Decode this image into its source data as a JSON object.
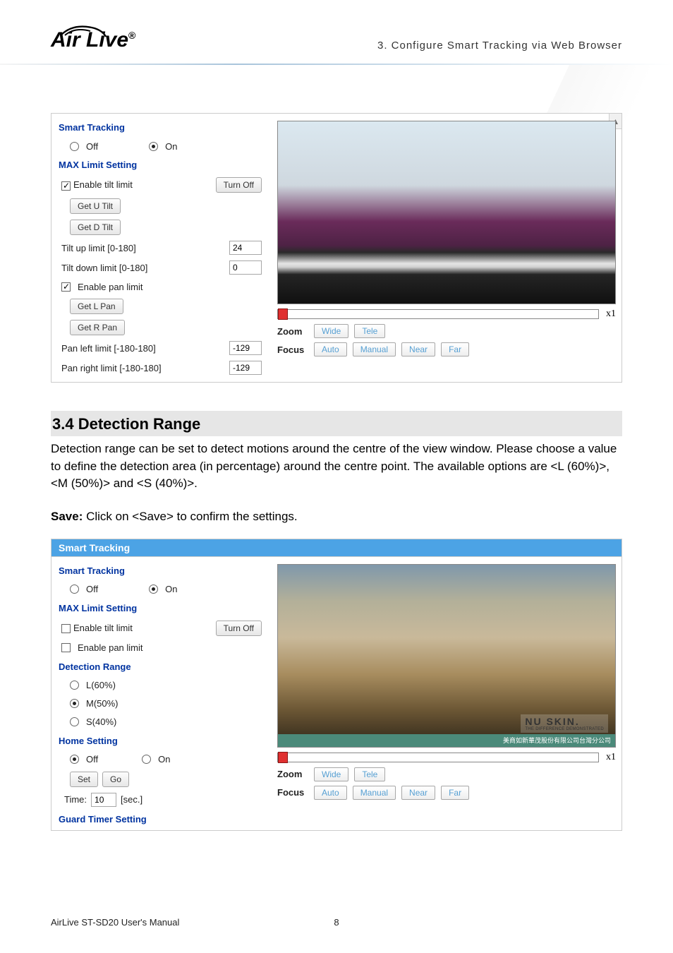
{
  "header": {
    "logo_text": "Air Live",
    "page_header": "3. Configure Smart Tracking via Web Browser"
  },
  "panel1": {
    "smart_tracking_hdr": "Smart Tracking",
    "off": "Off",
    "on": "On",
    "max_limit_hdr": "MAX Limit Setting",
    "enable_tilt": "Enable tilt limit",
    "turn_off": "Turn Off",
    "get_u_tilt": "Get U Tilt",
    "get_d_tilt": "Get D Tilt",
    "tilt_up_label": "Tilt up limit [0-180]",
    "tilt_up_val": "24",
    "tilt_down_label": "Tilt down limit [0-180]",
    "tilt_down_val": "0",
    "enable_pan": "Enable pan limit",
    "get_l_pan": "Get L Pan",
    "get_r_pan": "Get R Pan",
    "pan_left_label": "Pan left limit [-180-180]",
    "pan_left_val": "-129",
    "pan_right_label": "Pan right limit [-180-180]",
    "pan_right_val": "-129",
    "zoom_x": "x1",
    "zoom": "Zoom",
    "wide": "Wide",
    "tele": "Tele",
    "focus": "Focus",
    "auto": "Auto",
    "manual": "Manual",
    "near": "Near",
    "far": "Far"
  },
  "section": {
    "title": "3.4 Detection Range",
    "para": "Detection range can be set to detect motions around the centre of the view window. Please choose a value to define the detection area (in percentage) around the centre point. The available options are <L (60%)>, <M (50%)> and <S (40%)>.",
    "save_label": "Save:",
    "save_text": " Click on <Save> to confirm the settings."
  },
  "panel2": {
    "tab": "Smart Tracking",
    "smart_tracking_hdr": "Smart Tracking",
    "off": "Off",
    "on": "On",
    "max_limit_hdr": "MAX Limit Setting",
    "enable_tilt": "Enable tilt limit",
    "turn_off": "Turn Off",
    "enable_pan": "Enable pan limit",
    "detection_hdr": "Detection Range",
    "l60": "L(60%)",
    "m50": "M(50%)",
    "s40": "S(40%)",
    "home_hdr": "Home Setting",
    "set": "Set",
    "go": "Go",
    "time_lbl": "Time:",
    "time_val": "10",
    "time_unit": "[sec.]",
    "guard_hdr": "Guard Timer Setting",
    "zoom_x": "x1",
    "zoom": "Zoom",
    "wide": "Wide",
    "tele": "Tele",
    "focus": "Focus",
    "auto": "Auto",
    "manual": "Manual",
    "near": "Near",
    "far": "Far",
    "nuskin": "NU SKIN.",
    "nuskin_sub": "THE DIFFERENCE DEMONSTRATED",
    "greenband": "美商如新華茂股份有限公司台灣分公司"
  },
  "footer": {
    "manual": "AirLive ST-SD20 User's Manual",
    "page": "8"
  }
}
